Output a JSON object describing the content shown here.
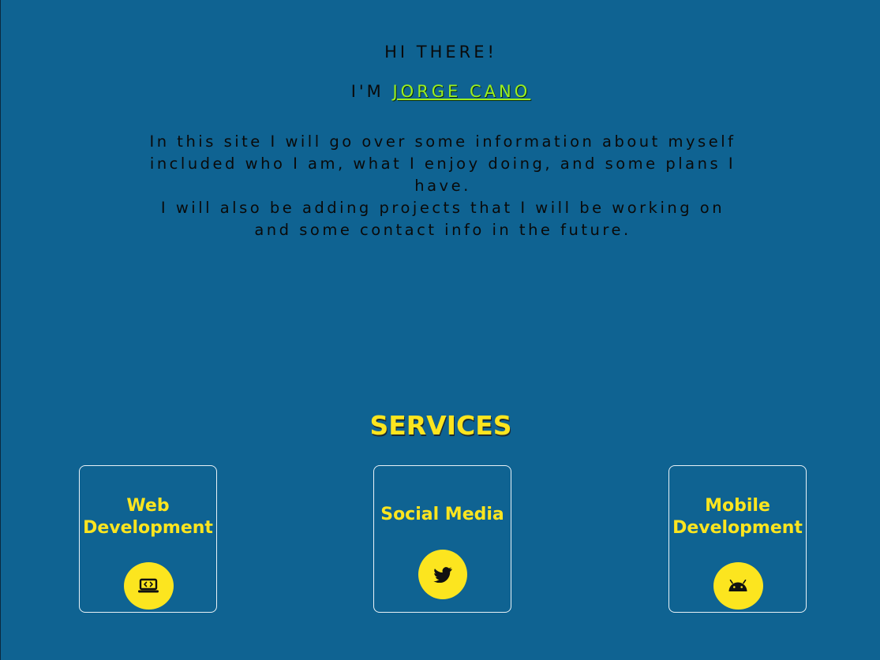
{
  "hero": {
    "greeting": "HI THERE!",
    "im_prefix": "I'M ",
    "name": "JORGE CANO",
    "intro_lines": [
      "In this site I will go over some information about myself",
      "included who I am, what I enjoy doing, and some plans I",
      "have.",
      "I will also be adding projects that I will be working on",
      "and some contact info in the future."
    ]
  },
  "services": {
    "title": "SERVICES",
    "cards": [
      {
        "title": "Web Development",
        "icon": "laptop-code-icon"
      },
      {
        "title": "Social Media",
        "icon": "twitter-icon"
      },
      {
        "title": "Mobile Development",
        "icon": "android-icon"
      }
    ]
  },
  "colors": {
    "background": "#0f6392",
    "accent_yellow": "#fce51f",
    "name_green": "#9bf01f",
    "text_dark": "#0a0a0a",
    "card_border": "#e9f2f7"
  }
}
